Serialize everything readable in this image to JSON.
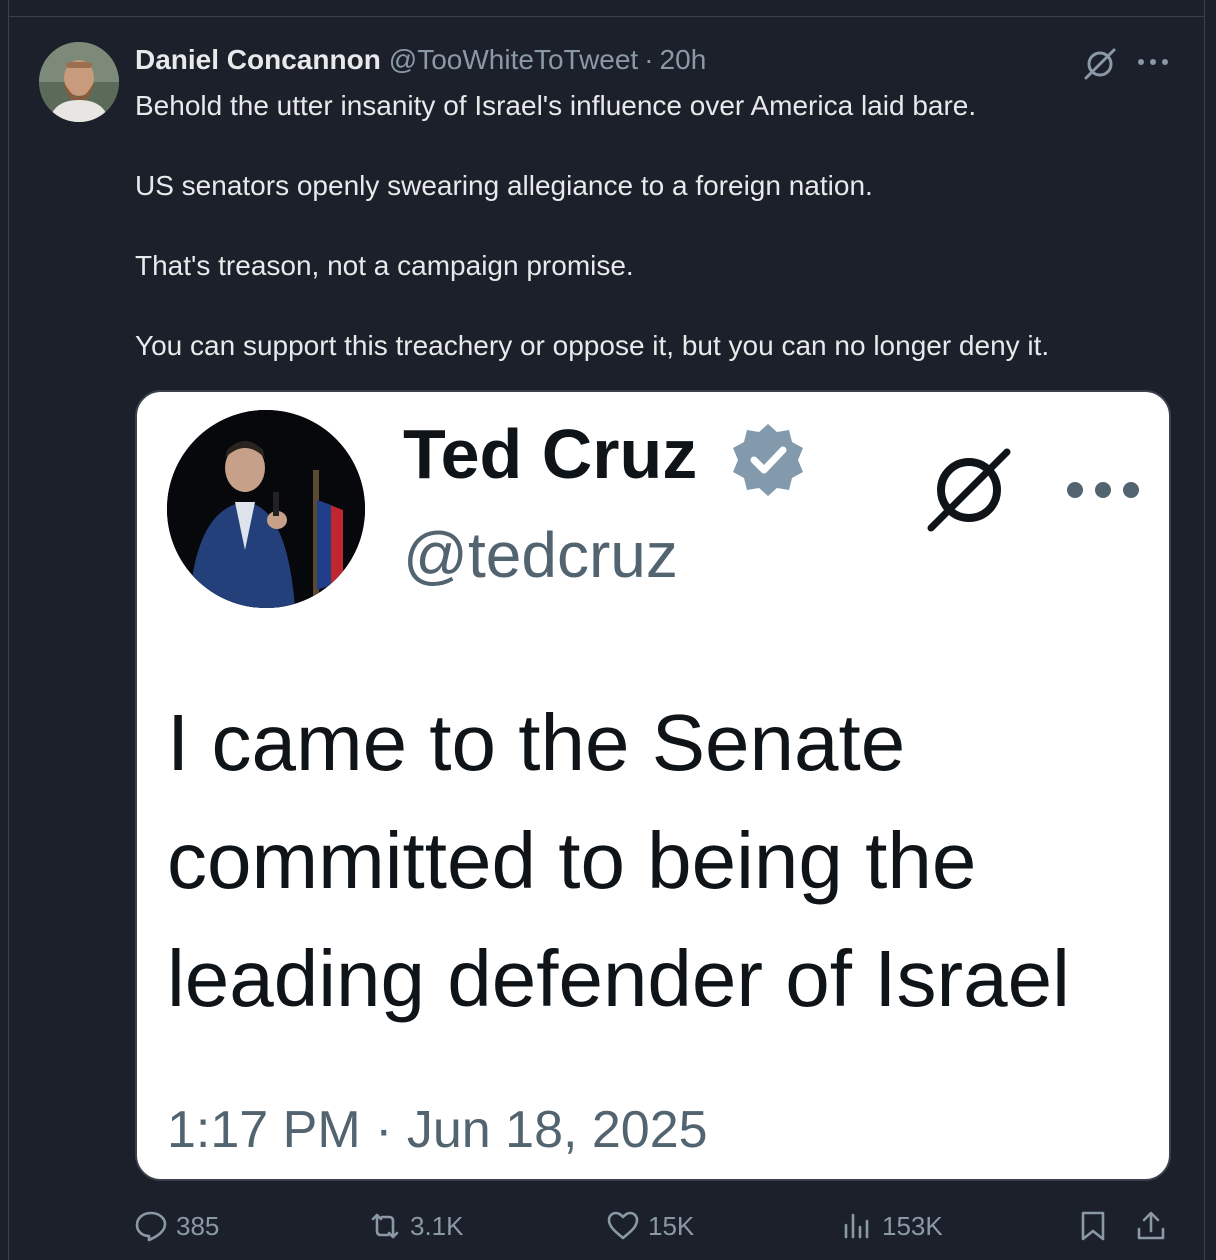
{
  "post": {
    "author_name": "Daniel Concannon",
    "author_handle": "@TooWhiteToTweet",
    "separator": "·",
    "time": "20h",
    "body": [
      "Behold the utter insanity of Israel's influence over America laid bare.",
      "US senators openly swearing allegiance to a foreign nation.",
      "That's treason, not a campaign promise.",
      "You can support this treachery or oppose it, but you can no longer deny it."
    ]
  },
  "quoted": {
    "name": "Ted Cruz",
    "handle": "@tedcruz",
    "text_lines": [
      "I came to the Senate",
      "committed to being the",
      "leading defender of Israel"
    ],
    "timestamp": "1:17 PM · Jun 18, 2025"
  },
  "actions": {
    "replies": "385",
    "reposts": "3.1K",
    "likes": "15K",
    "views": "153K"
  },
  "icons": {
    "grok": "grok-icon",
    "more": "more-icon",
    "verified": "verified-badge-icon",
    "reply": "reply-icon",
    "repost": "repost-icon",
    "like": "like-icon",
    "views": "views-icon",
    "bookmark": "bookmark-icon",
    "share": "share-icon"
  },
  "colors": {
    "background": "#1b202a",
    "text": "#e7e9ea",
    "muted": "#8b98a5",
    "verified": "#829aab"
  }
}
